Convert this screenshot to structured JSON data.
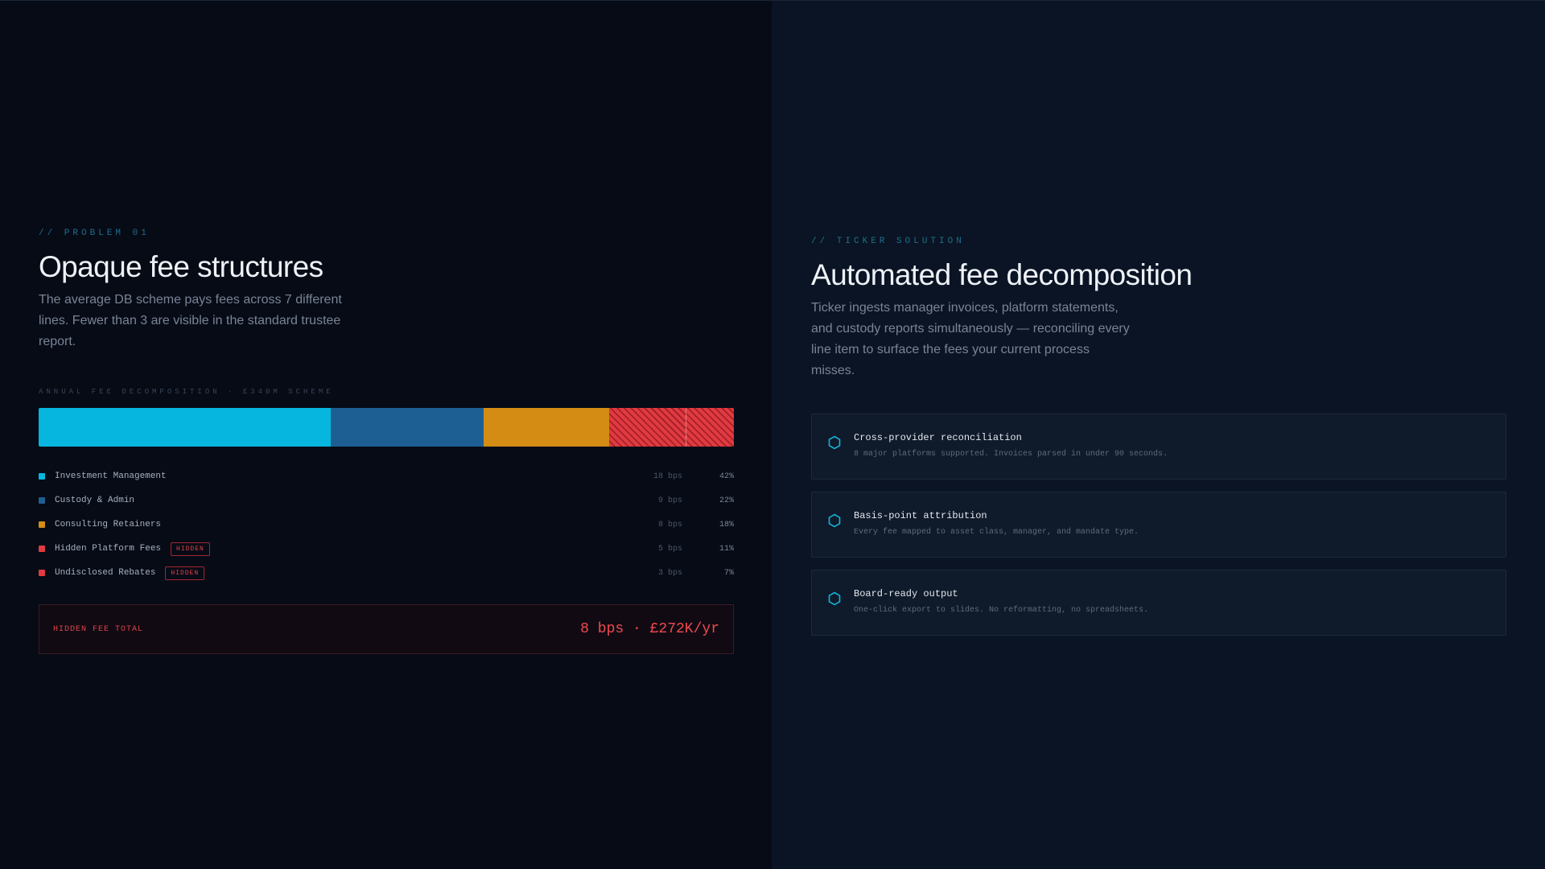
{
  "colors": {
    "investment": "#06b6de",
    "custody": "#1e5f93",
    "consulting": "#d48c14",
    "hidden": "#e03b41",
    "accent": "#1f6f8e"
  },
  "left": {
    "eyebrow": "// PROBLEM 01",
    "title": "Opaque fee structures",
    "lede": "The average DB scheme pays fees across 7 different lines. Fewer than 3 are visible in the standard trustee report.",
    "chart_title": "ANNUAL FEE DECOMPOSITION · £340M SCHEME",
    "total_label": "HIDDEN FEE TOTAL",
    "total_value": "8 bps · £272K/yr"
  },
  "chart_data": {
    "type": "bar",
    "title": "ANNUAL FEE DECOMPOSITION · £340M SCHEME",
    "categories": [
      "Investment Management",
      "Custody & Admin",
      "Consulting Retainers",
      "Hidden Platform Fees",
      "Undisclosed Rebates"
    ],
    "bps": [
      "18 bps",
      "9 bps",
      "8 bps",
      "5 bps",
      "3 bps"
    ],
    "pct_labels": [
      "42%",
      "22%",
      "18%",
      "11%",
      "7%"
    ],
    "values": [
      42,
      22,
      18,
      11,
      7
    ],
    "colors": [
      "#06b6de",
      "#1e5f93",
      "#d48c14",
      "#e03b41",
      "#e03b41"
    ],
    "hidden": [
      false,
      false,
      false,
      true,
      true
    ],
    "badge": "HIDDEN"
  },
  "right": {
    "eyebrow": "// TICKER SOLUTION",
    "title": "Automated fee decomposition",
    "lede": "Ticker ingests manager invoices, platform statements, and custody reports simultaneously — reconciling every line item to surface the fees your current process misses.",
    "cards": [
      {
        "icon": "hexagon-icon",
        "title": "Cross-provider reconciliation",
        "desc": "8 major platforms supported. Invoices parsed in under 90 seconds."
      },
      {
        "icon": "hexagon-icon",
        "title": "Basis-point attribution",
        "desc": "Every fee mapped to asset class, manager, and mandate type."
      },
      {
        "icon": "hexagon-icon",
        "title": "Board-ready output",
        "desc": "One-click export to slides. No reformatting, no spreadsheets."
      }
    ]
  }
}
